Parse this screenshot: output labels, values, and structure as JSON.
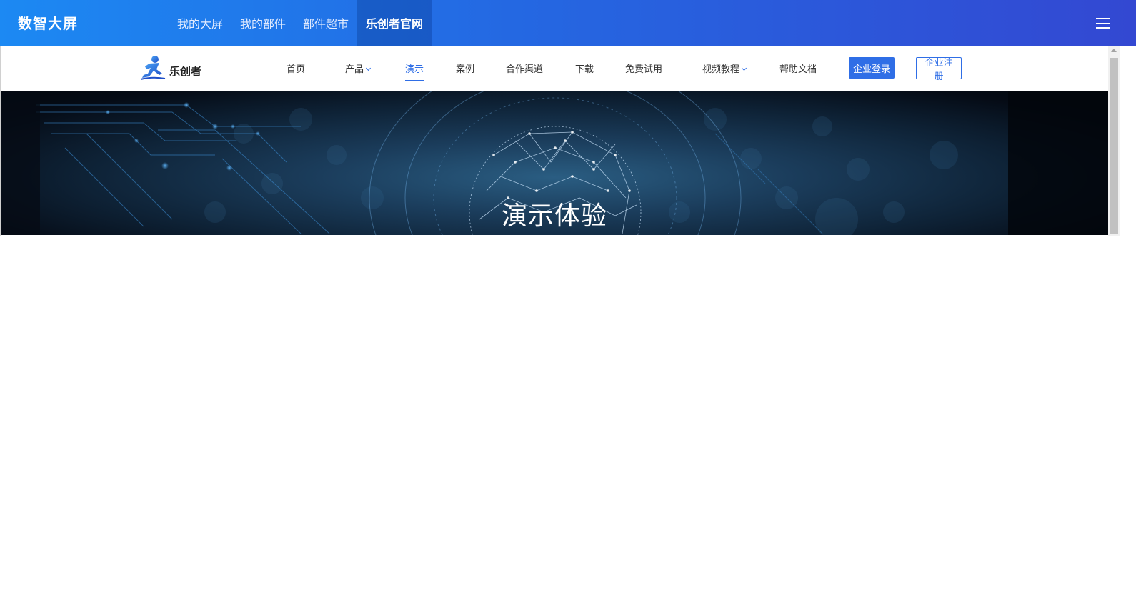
{
  "app": {
    "brand": "数智大屏",
    "top_nav": [
      {
        "label": "我的大屏",
        "active": false
      },
      {
        "label": "我的部件",
        "active": false
      },
      {
        "label": "部件超市",
        "active": false
      },
      {
        "label": "乐创者官网",
        "active": true
      }
    ],
    "menu_icon": "hamburger-icon"
  },
  "site": {
    "logo_text": "乐创者",
    "nav": [
      {
        "label": "首页",
        "active": false,
        "dropdown": false
      },
      {
        "label": "产品",
        "active": false,
        "dropdown": true
      },
      {
        "label": "演示",
        "active": true,
        "dropdown": false
      },
      {
        "label": "案例",
        "active": false,
        "dropdown": false
      },
      {
        "label": "合作渠道",
        "active": false,
        "dropdown": false
      },
      {
        "label": "下载",
        "active": false,
        "dropdown": false
      },
      {
        "label": "免费试用",
        "active": false,
        "dropdown": false
      },
      {
        "label": "视频教程",
        "active": false,
        "dropdown": true
      },
      {
        "label": "帮助文档",
        "active": false,
        "dropdown": false
      }
    ],
    "login_label": "企业登录",
    "register_label": "企业注册"
  },
  "banner": {
    "title": "演示体验"
  },
  "colors": {
    "accent": "#2f6ee6",
    "header_start": "#1c89f3",
    "header_end": "#3348d2"
  }
}
